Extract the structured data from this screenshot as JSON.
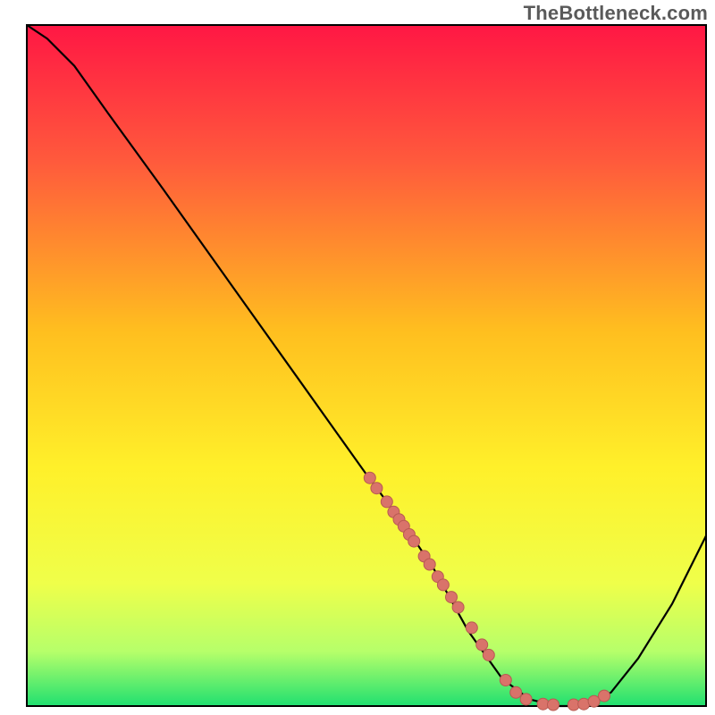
{
  "watermark": "TheBottleneck.com",
  "chart_data": {
    "type": "line",
    "title": "",
    "xlabel": "",
    "ylabel": "",
    "xlim": [
      0,
      100
    ],
    "ylim": [
      0,
      100
    ],
    "grid": false,
    "legend": false,
    "background_gradient_stops": [
      {
        "offset": 0.0,
        "color": "#ff1744"
      },
      {
        "offset": 0.2,
        "color": "#ff5a3c"
      },
      {
        "offset": 0.45,
        "color": "#ffbf1f"
      },
      {
        "offset": 0.65,
        "color": "#fff02a"
      },
      {
        "offset": 0.82,
        "color": "#efff4a"
      },
      {
        "offset": 0.92,
        "color": "#b6ff6a"
      },
      {
        "offset": 1.0,
        "color": "#20e070"
      }
    ],
    "curve": [
      {
        "x": 0,
        "y": 100
      },
      {
        "x": 3,
        "y": 98
      },
      {
        "x": 7,
        "y": 94
      },
      {
        "x": 12,
        "y": 87
      },
      {
        "x": 20,
        "y": 76
      },
      {
        "x": 30,
        "y": 62
      },
      {
        "x": 40,
        "y": 48
      },
      {
        "x": 50,
        "y": 34
      },
      {
        "x": 56,
        "y": 26
      },
      {
        "x": 60,
        "y": 20
      },
      {
        "x": 65,
        "y": 11
      },
      {
        "x": 70,
        "y": 4
      },
      {
        "x": 74,
        "y": 1
      },
      {
        "x": 78,
        "y": 0
      },
      {
        "x": 82,
        "y": 0
      },
      {
        "x": 86,
        "y": 2
      },
      {
        "x": 90,
        "y": 7
      },
      {
        "x": 95,
        "y": 15
      },
      {
        "x": 100,
        "y": 25
      }
    ],
    "scatter_color": "#d9736a",
    "scatter_stroke": "#b85a52",
    "scatter": [
      {
        "x": 50.5,
        "y": 33.5
      },
      {
        "x": 51.5,
        "y": 32
      },
      {
        "x": 53.0,
        "y": 30
      },
      {
        "x": 54.0,
        "y": 28.5
      },
      {
        "x": 54.8,
        "y": 27.4
      },
      {
        "x": 55.5,
        "y": 26.4
      },
      {
        "x": 56.3,
        "y": 25.2
      },
      {
        "x": 57.0,
        "y": 24.2
      },
      {
        "x": 58.5,
        "y": 22
      },
      {
        "x": 59.3,
        "y": 20.8
      },
      {
        "x": 60.5,
        "y": 19
      },
      {
        "x": 61.3,
        "y": 17.8
      },
      {
        "x": 62.5,
        "y": 16
      },
      {
        "x": 63.5,
        "y": 14.5
      },
      {
        "x": 65.5,
        "y": 11.5
      },
      {
        "x": 67.0,
        "y": 9
      },
      {
        "x": 68.0,
        "y": 7.5
      },
      {
        "x": 70.5,
        "y": 3.8
      },
      {
        "x": 72.0,
        "y": 2
      },
      {
        "x": 73.5,
        "y": 1
      },
      {
        "x": 76.0,
        "y": 0.3
      },
      {
        "x": 77.5,
        "y": 0.2
      },
      {
        "x": 80.5,
        "y": 0.2
      },
      {
        "x": 82.0,
        "y": 0.3
      },
      {
        "x": 83.5,
        "y": 0.7
      },
      {
        "x": 85.0,
        "y": 1.5
      }
    ]
  }
}
